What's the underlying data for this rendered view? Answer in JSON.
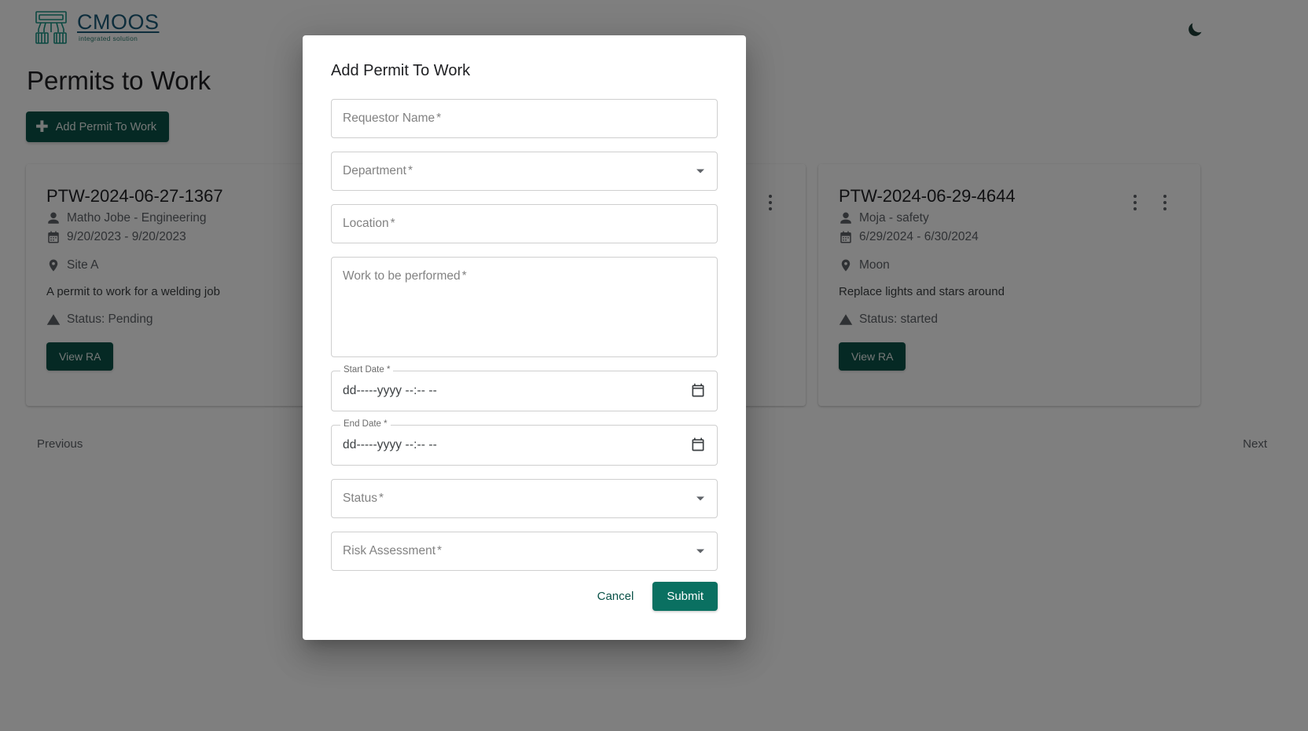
{
  "app": {
    "logo_title": "CMOOS",
    "logo_subtitle": "integrated solution",
    "theme_toggle_icon": "moon-icon",
    "brand_color": "#0a5248",
    "accent_color": "#0a7061",
    "logo_text_color": "#1b5a78",
    "logo_mark_color": "#169182"
  },
  "page": {
    "title": "Permits to Work",
    "add_button_label": "Add Permit To Work",
    "add_button_icon": "plus-icon"
  },
  "cards": [
    {
      "id": "PTW-2024-06-27-1367",
      "requestor": "Matho Jobe - Engineering",
      "dates": "9/20/2023 - 9/20/2023",
      "location": "Site A",
      "description": "A permit to work for a welding job",
      "status": "Status: Pending",
      "action_label": "View RA",
      "menu_icon": "more-vert-icon"
    },
    {
      "id": "PTW-2024-06-29-4644",
      "requestor": "Moja - safety",
      "dates": "6/29/2024 - 6/30/2024",
      "location": "Moon",
      "description": "Replace lights and stars around",
      "status": "Status: started",
      "action_label": "View RA",
      "menu_icon": "more-vert-icon"
    }
  ],
  "pagination": {
    "previous_label": "Previous",
    "next_label": "Next"
  },
  "dialog": {
    "title": "Add Permit To Work",
    "fields": {
      "requestor_name": {
        "label": "Requestor Name",
        "required_mark": "*",
        "value": ""
      },
      "department": {
        "label": "Department",
        "required_mark": "*",
        "value": ""
      },
      "location": {
        "label": "Location",
        "required_mark": "*",
        "value": ""
      },
      "work_to_be_performed": {
        "label": "Work to be performed",
        "required_mark": "*",
        "value": ""
      },
      "start_date": {
        "label": "Start Date *",
        "value": "dd-----yyyy --:-- --"
      },
      "end_date": {
        "label": "End Date *",
        "value": "dd-----yyyy --:-- --"
      },
      "status": {
        "label": "Status",
        "required_mark": "*",
        "value": ""
      },
      "risk_assessment": {
        "label": "Risk Assessment",
        "required_mark": "*",
        "value": ""
      }
    },
    "cancel_label": "Cancel",
    "submit_label": "Submit"
  }
}
